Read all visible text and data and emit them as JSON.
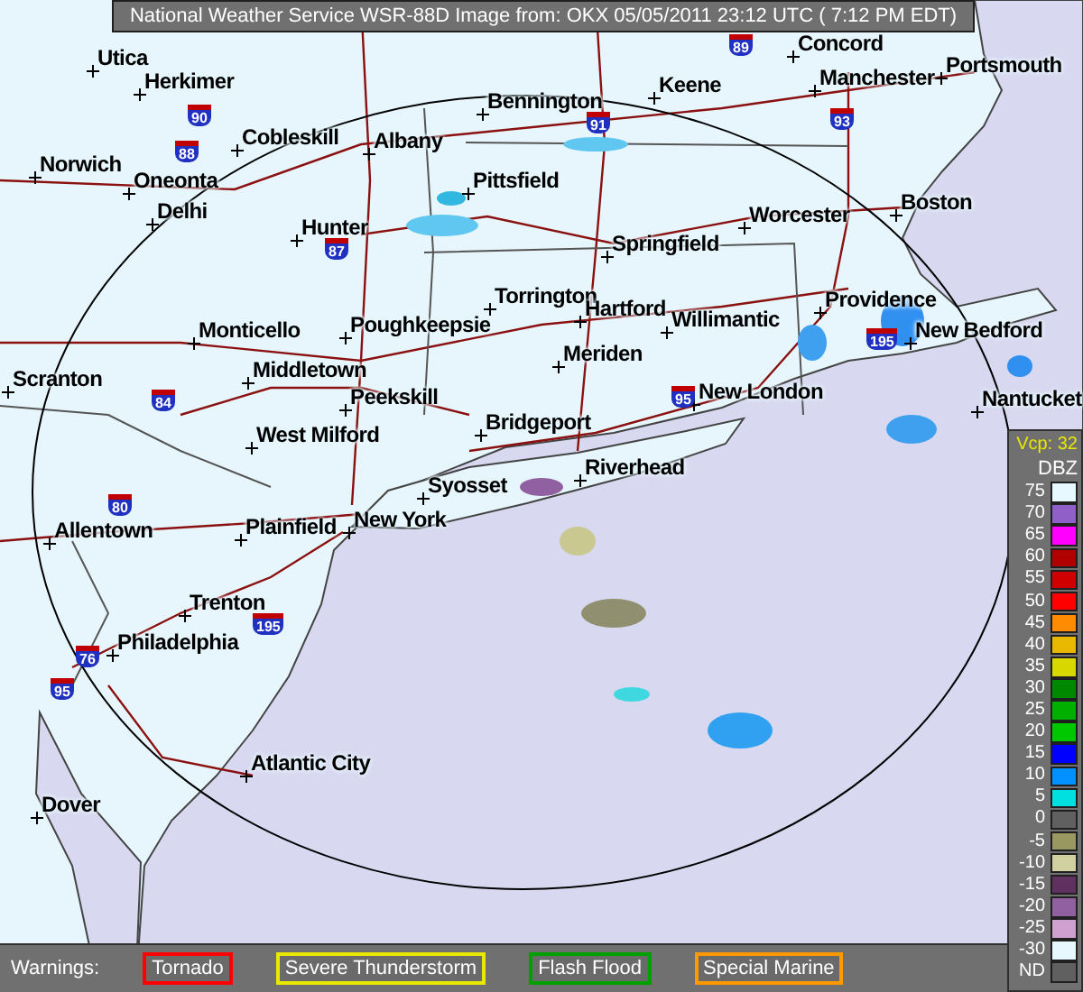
{
  "title_bar": {
    "text": "National Weather Service WSR-88D Image from:  OKX  05/05/2011  23:12 UTC ( 7:12 PM EDT)"
  },
  "map": {
    "cities": [
      "Utica",
      "Concord",
      "Portsmouth",
      "Herkimer",
      "Bennington",
      "Keene",
      "Manchester",
      "Cobleskill",
      "Albany",
      "Norwich",
      "Oneonta",
      "Pittsfield",
      "Delhi",
      "Worcester",
      "Boston",
      "Hunter",
      "Springfield",
      "Monticello",
      "Poughkeepsie",
      "Torrington",
      "Hartford",
      "Willimantic",
      "Providence",
      "New Bedford",
      "Scranton",
      "Middletown",
      "Meriden",
      "Peekskill",
      "New London",
      "Nantucket",
      "West Milford",
      "Bridgeport",
      "Syosset",
      "Riverhead",
      "Allentown",
      "Plainfield",
      "New York",
      "Trenton",
      "Philadelphia",
      "Atlantic City",
      "Dover"
    ],
    "highway_shields": [
      "89",
      "90",
      "91",
      "93",
      "88",
      "87",
      "195",
      "84",
      "95",
      "80",
      "195",
      "76",
      "95"
    ]
  },
  "legend": {
    "mode": "Vcp: 32",
    "unit": "DBZ",
    "levels": [
      {
        "label": "75",
        "color": "#e8f8ff"
      },
      {
        "label": "70",
        "color": "#9060c8"
      },
      {
        "label": "65",
        "color": "#ff00ff"
      },
      {
        "label": "60",
        "color": "#b00000"
      },
      {
        "label": "55",
        "color": "#d00000"
      },
      {
        "label": "50",
        "color": "#ff0000"
      },
      {
        "label": "45",
        "color": "#ff8c00"
      },
      {
        "label": "40",
        "color": "#e8b800"
      },
      {
        "label": "35",
        "color": "#d8d800"
      },
      {
        "label": "30",
        "color": "#008800"
      },
      {
        "label": "25",
        "color": "#00b000"
      },
      {
        "label": "20",
        "color": "#00c800"
      },
      {
        "label": "15",
        "color": "#0000ff"
      },
      {
        "label": "10",
        "color": "#0090ff"
      },
      {
        "label": "5",
        "color": "#00e0e0"
      },
      {
        "label": "0",
        "color": "#606060"
      },
      {
        "label": "-5",
        "color": "#989860"
      },
      {
        "label": "-10",
        "color": "#d0d0a0"
      },
      {
        "label": "-15",
        "color": "#603060"
      },
      {
        "label": "-20",
        "color": "#9060a0"
      },
      {
        "label": "-25",
        "color": "#d0a0d0"
      },
      {
        "label": "-30",
        "color": "#e8f8ff"
      },
      {
        "label": "ND",
        "color": "#606060"
      }
    ]
  },
  "warnings": {
    "label": "Warnings:",
    "items": [
      {
        "label": "Tornado",
        "color": "#ff0000"
      },
      {
        "label": "Severe Thunderstorm",
        "color": "#e8e800"
      },
      {
        "label": "Flash Flood",
        "color": "#00a000"
      },
      {
        "label": "Special Marine",
        "color": "#ff9900"
      }
    ]
  }
}
